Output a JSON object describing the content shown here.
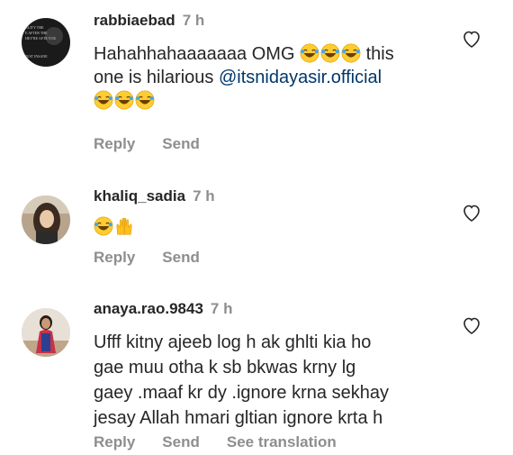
{
  "comments": [
    {
      "username": "rabbiaebad",
      "time": "7 h",
      "text_lines": [
        "Hahahhahaaaaaaa OMG",
        "this"
      ],
      "text_line2": "one is hilarious",
      "mention": "@itsnidayasir.official",
      "emojis_inline": [
        "laughing-emoji",
        "laughing-emoji",
        "laughing-emoji"
      ],
      "emojis_row3": [
        "laughing-emoji",
        "laughing-emoji",
        "laughing-emoji"
      ],
      "avatar_lines": [
        "ALITY THE",
        "E AFTER THE",
        "HEY'RE AFTE YOU",
        "JUST INSANE"
      ],
      "actions": [
        "Reply",
        "Send"
      ]
    },
    {
      "username": "khaliq_sadia",
      "time": "7 h",
      "emojis": [
        "laughing-emoji",
        "raised-hands-emoji"
      ],
      "actions": [
        "Reply",
        "Send"
      ]
    },
    {
      "username": "anaya.rao.9843",
      "time": "7 h",
      "text_lines": [
        "Ufff kitny ajeeb log h ak ghlti kia ho",
        "gae muu otha k sb bkwas krny lg",
        "gaey .maaf kr dy .ignore krna sekhay",
        "jesay Allah hmari gltian ignore krta h"
      ],
      "actions": [
        "Reply",
        "Send",
        "See translation"
      ]
    }
  ],
  "colors": {
    "text": "#262626",
    "secondary": "#8e8e8e",
    "mention": "#00376b"
  }
}
